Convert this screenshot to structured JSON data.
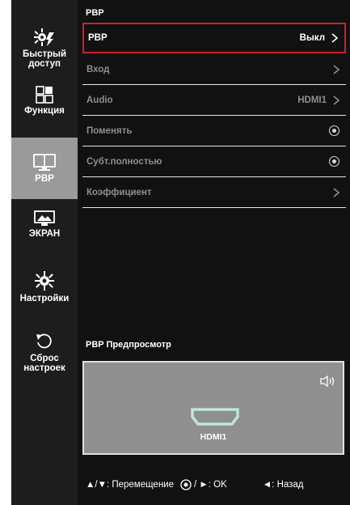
{
  "sidebar": {
    "items": [
      {
        "label": "Быстрый\nдоступ",
        "icon": "quick-access-icon"
      },
      {
        "label": "Функция",
        "icon": "function-icon"
      },
      {
        "label": "PBP",
        "icon": "pbp-icon",
        "active": true
      },
      {
        "label": "ЭКРАН",
        "icon": "screen-icon"
      },
      {
        "label": "Настройки",
        "icon": "settings-icon"
      },
      {
        "label": "Сброс\nнастроек",
        "icon": "reset-icon"
      }
    ]
  },
  "main": {
    "title": "PBP",
    "rows": [
      {
        "label": "PBP",
        "value": "Выкл",
        "control": "chevron"
      },
      {
        "label": "Вход",
        "value": "",
        "control": "chevron"
      },
      {
        "label": "Audio",
        "value": "HDMI1",
        "control": "chevron"
      },
      {
        "label": "Поменять",
        "value": "",
        "control": "radio"
      },
      {
        "label": "Субт.полностью",
        "value": "",
        "control": "radio"
      },
      {
        "label": "Коэффициент",
        "value": "",
        "control": "chevron"
      }
    ],
    "preview_title": "PBP Предпросмотр",
    "preview_input": "HDMI1"
  },
  "footer": {
    "move": "▲/▼: Перемещение",
    "ok_prefix": "/ ►: OK",
    "back": "◄: Назад"
  },
  "colors": {
    "highlight_border": "#c8232c",
    "active_sidebar": "#9a9a9a",
    "background": "#111111"
  }
}
